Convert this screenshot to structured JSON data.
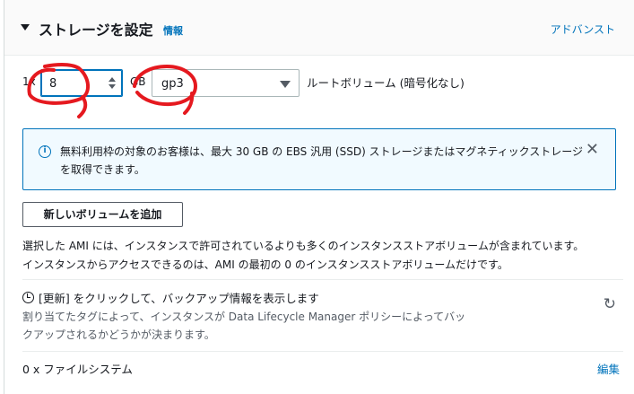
{
  "header": {
    "title": "ストレージを設定",
    "info": "情報",
    "advanced": "アドバンスト"
  },
  "volume": {
    "count_label": "1x",
    "size_value": "8",
    "unit": "GB",
    "type_value": "gp3",
    "root_label": "ルートボリューム (暗号化なし)"
  },
  "alert": {
    "message": "無料利用枠の対象のお客様は、最大 30 GB の EBS 汎用 (SSD) ストレージまたはマグネティックストレージを取得できます。",
    "close": "✕"
  },
  "add_button": "新しいボリュームを追加",
  "description": {
    "line1": "選択した AMI には、インスタンスで許可されているよりも多くのインスタンスストアボリュームが含まれています。",
    "line2": "インスタンスからアクセスできるのは、AMI の最初の 0 のインスタンスストアボリュームだけです。"
  },
  "refresh": {
    "title": "[更新] をクリックして、バックアップ情報を表示します",
    "desc": "割り当てたタグによって、インスタンスが Data Lifecycle Manager ポリシーによってバックアップされるかどうかが決まります。",
    "icon": "↻"
  },
  "filesystem": {
    "label": "0 x ファイルシステム",
    "edit": "編集"
  },
  "annotation_color": "#e5191f"
}
